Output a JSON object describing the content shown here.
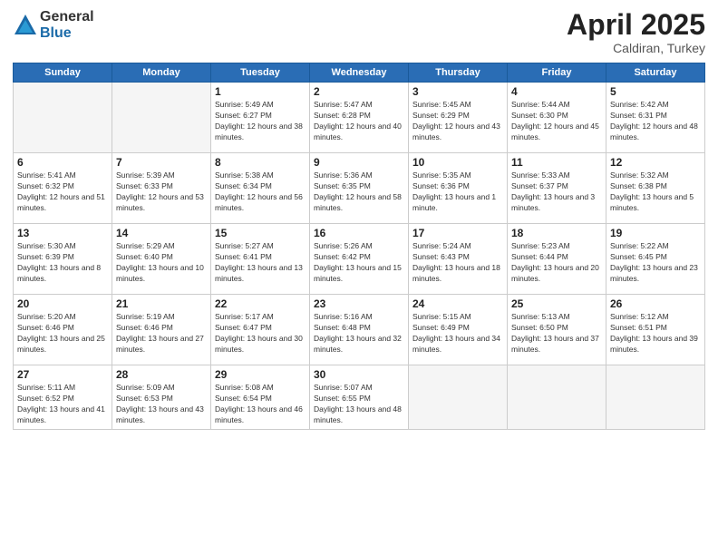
{
  "logo": {
    "general": "General",
    "blue": "Blue"
  },
  "header": {
    "title": "April 2025",
    "subtitle": "Caldiran, Turkey"
  },
  "weekdays": [
    "Sunday",
    "Monday",
    "Tuesday",
    "Wednesday",
    "Thursday",
    "Friday",
    "Saturday"
  ],
  "weeks": [
    [
      {
        "day": "",
        "empty": true
      },
      {
        "day": "",
        "empty": true
      },
      {
        "day": "1",
        "sunrise": "Sunrise: 5:49 AM",
        "sunset": "Sunset: 6:27 PM",
        "daylight": "Daylight: 12 hours and 38 minutes."
      },
      {
        "day": "2",
        "sunrise": "Sunrise: 5:47 AM",
        "sunset": "Sunset: 6:28 PM",
        "daylight": "Daylight: 12 hours and 40 minutes."
      },
      {
        "day": "3",
        "sunrise": "Sunrise: 5:45 AM",
        "sunset": "Sunset: 6:29 PM",
        "daylight": "Daylight: 12 hours and 43 minutes."
      },
      {
        "day": "4",
        "sunrise": "Sunrise: 5:44 AM",
        "sunset": "Sunset: 6:30 PM",
        "daylight": "Daylight: 12 hours and 45 minutes."
      },
      {
        "day": "5",
        "sunrise": "Sunrise: 5:42 AM",
        "sunset": "Sunset: 6:31 PM",
        "daylight": "Daylight: 12 hours and 48 minutes."
      }
    ],
    [
      {
        "day": "6",
        "sunrise": "Sunrise: 5:41 AM",
        "sunset": "Sunset: 6:32 PM",
        "daylight": "Daylight: 12 hours and 51 minutes."
      },
      {
        "day": "7",
        "sunrise": "Sunrise: 5:39 AM",
        "sunset": "Sunset: 6:33 PM",
        "daylight": "Daylight: 12 hours and 53 minutes."
      },
      {
        "day": "8",
        "sunrise": "Sunrise: 5:38 AM",
        "sunset": "Sunset: 6:34 PM",
        "daylight": "Daylight: 12 hours and 56 minutes."
      },
      {
        "day": "9",
        "sunrise": "Sunrise: 5:36 AM",
        "sunset": "Sunset: 6:35 PM",
        "daylight": "Daylight: 12 hours and 58 minutes."
      },
      {
        "day": "10",
        "sunrise": "Sunrise: 5:35 AM",
        "sunset": "Sunset: 6:36 PM",
        "daylight": "Daylight: 13 hours and 1 minute."
      },
      {
        "day": "11",
        "sunrise": "Sunrise: 5:33 AM",
        "sunset": "Sunset: 6:37 PM",
        "daylight": "Daylight: 13 hours and 3 minutes."
      },
      {
        "day": "12",
        "sunrise": "Sunrise: 5:32 AM",
        "sunset": "Sunset: 6:38 PM",
        "daylight": "Daylight: 13 hours and 5 minutes."
      }
    ],
    [
      {
        "day": "13",
        "sunrise": "Sunrise: 5:30 AM",
        "sunset": "Sunset: 6:39 PM",
        "daylight": "Daylight: 13 hours and 8 minutes."
      },
      {
        "day": "14",
        "sunrise": "Sunrise: 5:29 AM",
        "sunset": "Sunset: 6:40 PM",
        "daylight": "Daylight: 13 hours and 10 minutes."
      },
      {
        "day": "15",
        "sunrise": "Sunrise: 5:27 AM",
        "sunset": "Sunset: 6:41 PM",
        "daylight": "Daylight: 13 hours and 13 minutes."
      },
      {
        "day": "16",
        "sunrise": "Sunrise: 5:26 AM",
        "sunset": "Sunset: 6:42 PM",
        "daylight": "Daylight: 13 hours and 15 minutes."
      },
      {
        "day": "17",
        "sunrise": "Sunrise: 5:24 AM",
        "sunset": "Sunset: 6:43 PM",
        "daylight": "Daylight: 13 hours and 18 minutes."
      },
      {
        "day": "18",
        "sunrise": "Sunrise: 5:23 AM",
        "sunset": "Sunset: 6:44 PM",
        "daylight": "Daylight: 13 hours and 20 minutes."
      },
      {
        "day": "19",
        "sunrise": "Sunrise: 5:22 AM",
        "sunset": "Sunset: 6:45 PM",
        "daylight": "Daylight: 13 hours and 23 minutes."
      }
    ],
    [
      {
        "day": "20",
        "sunrise": "Sunrise: 5:20 AM",
        "sunset": "Sunset: 6:46 PM",
        "daylight": "Daylight: 13 hours and 25 minutes."
      },
      {
        "day": "21",
        "sunrise": "Sunrise: 5:19 AM",
        "sunset": "Sunset: 6:46 PM",
        "daylight": "Daylight: 13 hours and 27 minutes."
      },
      {
        "day": "22",
        "sunrise": "Sunrise: 5:17 AM",
        "sunset": "Sunset: 6:47 PM",
        "daylight": "Daylight: 13 hours and 30 minutes."
      },
      {
        "day": "23",
        "sunrise": "Sunrise: 5:16 AM",
        "sunset": "Sunset: 6:48 PM",
        "daylight": "Daylight: 13 hours and 32 minutes."
      },
      {
        "day": "24",
        "sunrise": "Sunrise: 5:15 AM",
        "sunset": "Sunset: 6:49 PM",
        "daylight": "Daylight: 13 hours and 34 minutes."
      },
      {
        "day": "25",
        "sunrise": "Sunrise: 5:13 AM",
        "sunset": "Sunset: 6:50 PM",
        "daylight": "Daylight: 13 hours and 37 minutes."
      },
      {
        "day": "26",
        "sunrise": "Sunrise: 5:12 AM",
        "sunset": "Sunset: 6:51 PM",
        "daylight": "Daylight: 13 hours and 39 minutes."
      }
    ],
    [
      {
        "day": "27",
        "sunrise": "Sunrise: 5:11 AM",
        "sunset": "Sunset: 6:52 PM",
        "daylight": "Daylight: 13 hours and 41 minutes."
      },
      {
        "day": "28",
        "sunrise": "Sunrise: 5:09 AM",
        "sunset": "Sunset: 6:53 PM",
        "daylight": "Daylight: 13 hours and 43 minutes."
      },
      {
        "day": "29",
        "sunrise": "Sunrise: 5:08 AM",
        "sunset": "Sunset: 6:54 PM",
        "daylight": "Daylight: 13 hours and 46 minutes."
      },
      {
        "day": "30",
        "sunrise": "Sunrise: 5:07 AM",
        "sunset": "Sunset: 6:55 PM",
        "daylight": "Daylight: 13 hours and 48 minutes."
      },
      {
        "day": "",
        "empty": true
      },
      {
        "day": "",
        "empty": true
      },
      {
        "day": "",
        "empty": true
      }
    ]
  ]
}
